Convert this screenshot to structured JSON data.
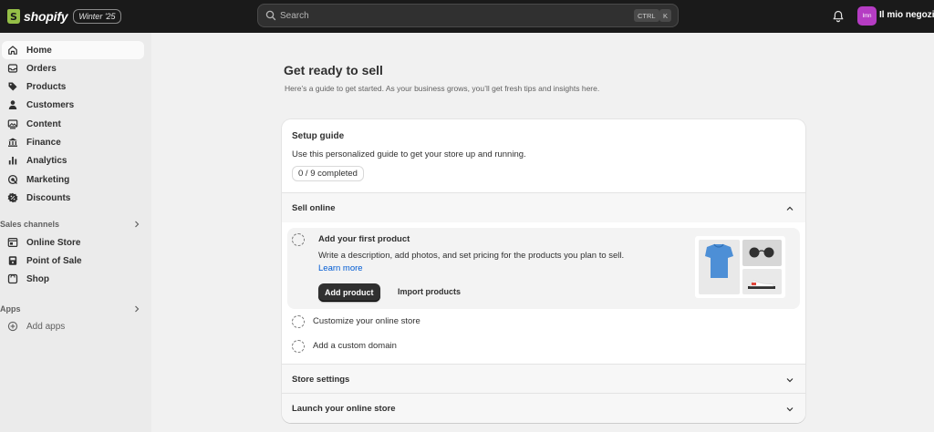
{
  "topbar": {
    "brand": "shopify",
    "edition": "Winter '25",
    "search_placeholder": "Search",
    "shortcut_ctrl": "CTRL",
    "shortcut_k": "K",
    "avatar_initials": "Imn",
    "store_name": "Il mio negozio",
    "avatar_color": "#b53cc3"
  },
  "sidebar": {
    "items": [
      {
        "label": "Home",
        "icon": "home-icon"
      },
      {
        "label": "Orders",
        "icon": "inbox-icon"
      },
      {
        "label": "Products",
        "icon": "tag-icon"
      },
      {
        "label": "Customers",
        "icon": "person-icon"
      },
      {
        "label": "Content",
        "icon": "content-icon"
      },
      {
        "label": "Finance",
        "icon": "bank-icon"
      },
      {
        "label": "Analytics",
        "icon": "bar-chart-icon"
      },
      {
        "label": "Marketing",
        "icon": "target-icon"
      },
      {
        "label": "Discounts",
        "icon": "discount-icon"
      }
    ],
    "sales_channels_heading": "Sales channels",
    "sales_channels": [
      {
        "label": "Online Store",
        "icon": "store-icon"
      },
      {
        "label": "Point of Sale",
        "icon": "pos-icon"
      },
      {
        "label": "Shop",
        "icon": "shop-bag-icon"
      }
    ],
    "apps_heading": "Apps",
    "add_apps": "Add apps"
  },
  "main": {
    "title": "Get ready to sell",
    "subtitle": "Here’s a guide to get started. As your business grows, you’ll get fresh tips and insights here.",
    "setup": {
      "title": "Setup guide",
      "description": "Use this personalized guide to get your store up and running.",
      "progress": "0 / 9 completed",
      "sections": {
        "sell_online": "Sell online",
        "store_settings": "Store settings",
        "launch": "Launch your online store"
      },
      "first_task": {
        "title": "Add your first product",
        "description": "Write a description, add photos, and set pricing for the products you plan to sell.",
        "learn_more": "Learn more",
        "primary_button": "Add product",
        "secondary_button": "Import products"
      },
      "other_tasks": [
        "Customize your online store",
        "Add a custom domain"
      ]
    }
  },
  "colors": {
    "topbar_bg": "#1a1a1a",
    "brand_green": "#95bf47",
    "link_blue": "#005bd3",
    "primary_button": "#303030"
  }
}
